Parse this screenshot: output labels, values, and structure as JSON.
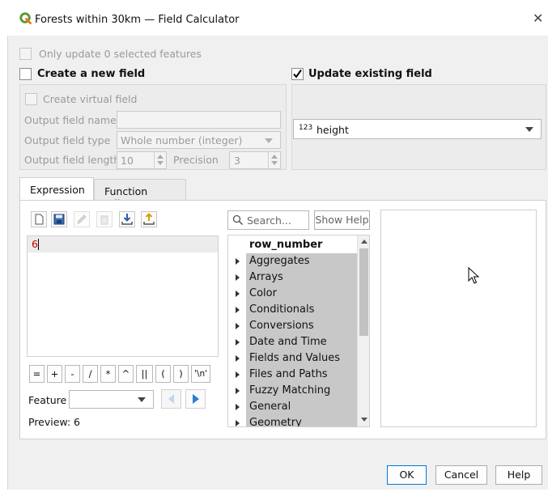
{
  "window": {
    "title": "Forests within 30km — Field Calculator",
    "close_glyph": "✕"
  },
  "top": {
    "only_update_label": "Only update 0 selected features",
    "create_new_field_label": "Create a new field",
    "update_existing_label": "Update existing field"
  },
  "new_field": {
    "virtual_label": "Create virtual field",
    "name_label": "Output field name",
    "name_value": "",
    "type_label": "Output field type",
    "type_value": "Whole number (integer)",
    "length_label": "Output field length",
    "length_value": "10",
    "precision_label": "Precision",
    "precision_value": "3"
  },
  "existing_field": {
    "type_badge": "123",
    "value": "height"
  },
  "tabs": [
    {
      "label": "Expression"
    },
    {
      "label": "Function Editor"
    }
  ],
  "expression": {
    "text": "6",
    "line_number": "6",
    "operators": [
      "=",
      "+",
      "-",
      "/",
      "*",
      "^",
      "||",
      "(",
      ")",
      "'\\n'"
    ],
    "feature_label": "Feature",
    "feature_value": "",
    "preview_label": "Preview:",
    "preview_value": "6"
  },
  "functions": {
    "search_placeholder": "Search...",
    "show_help_label": "Show Help",
    "selected_item": "row_number",
    "groups": [
      "Aggregates",
      "Arrays",
      "Color",
      "Conditionals",
      "Conversions",
      "Date and Time",
      "Fields and Values",
      "Files and Paths",
      "Fuzzy Matching",
      "General",
      "Geometry"
    ]
  },
  "buttons": {
    "ok": "OK",
    "cancel": "Cancel",
    "help": "Help"
  },
  "colors": {
    "qgis_green": "#589632",
    "qgis_yellow": "#ee7913",
    "accent_blue": "#0078d7",
    "expression_red": "#c00000"
  }
}
